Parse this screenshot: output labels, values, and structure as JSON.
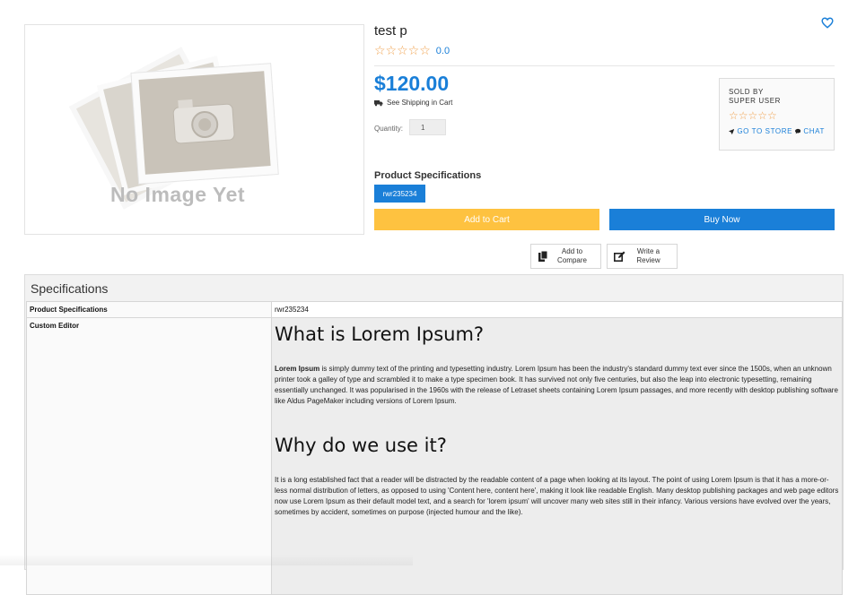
{
  "product": {
    "title": "test p",
    "rating_stars": "☆☆☆☆☆",
    "rating_value": "0.0",
    "price": "$120.00",
    "shipping_text": "See Shipping in Cart",
    "quantity_label": "Quantity:",
    "quantity_value": "1",
    "image_placeholder_text": "No Image Yet"
  },
  "seller": {
    "sold_by": "SOLD BY",
    "name": "SUPER USER",
    "stars": "☆☆☆☆☆",
    "go_to_store": "GO TO STORE",
    "chat": "CHAT"
  },
  "specs_block": {
    "heading": "Product Specifications",
    "chip": "rwr235234"
  },
  "buttons": {
    "add_to_cart": "Add to Cart",
    "buy_now": "Buy Now",
    "compare_l1": "Add to",
    "compare_l2": "Compare",
    "review_l1": "Write a",
    "review_l2": "Review"
  },
  "spec_panel": {
    "title": "Specifications",
    "rows": [
      {
        "key": "Product Specifications",
        "value": "rwr235234"
      },
      {
        "key": "Custom Editor"
      }
    ],
    "editor": {
      "h1": "What is Lorem Ipsum?",
      "p1_bold": "Lorem Ipsum",
      "p1_rest": " is simply dummy text of the printing and typesetting industry. Lorem Ipsum has been the industry's standard dummy text ever since the 1500s, when an unknown printer took a galley of type and scrambled it to make a type specimen book. It has survived not only five centuries, but also the leap into electronic typesetting, remaining essentially unchanged. It was popularised in the 1960s with the release of Letraset sheets containing Lorem Ipsum passages, and more recently with desktop publishing software like Aldus PageMaker including versions of Lorem Ipsum.",
      "h2": "Why do we use it?",
      "p2": "It is a long established fact that a reader will be distracted by the readable content of a page when looking at its layout. The point of using Lorem Ipsum is that it has a more-or-less normal distribution of letters, as opposed to using 'Content here, content here', making it look like readable English. Many desktop publishing packages and web page editors now use Lorem Ipsum as their default model text, and a search for 'lorem ipsum' will uncover many web sites still in their infancy. Various versions have evolved over the years, sometimes by accident, sometimes on purpose (injected humour and the like)."
    }
  },
  "colors": {
    "accent_blue": "#1a7fd8",
    "star_orange": "#f0a04b",
    "cart_yellow": "#fec240"
  }
}
